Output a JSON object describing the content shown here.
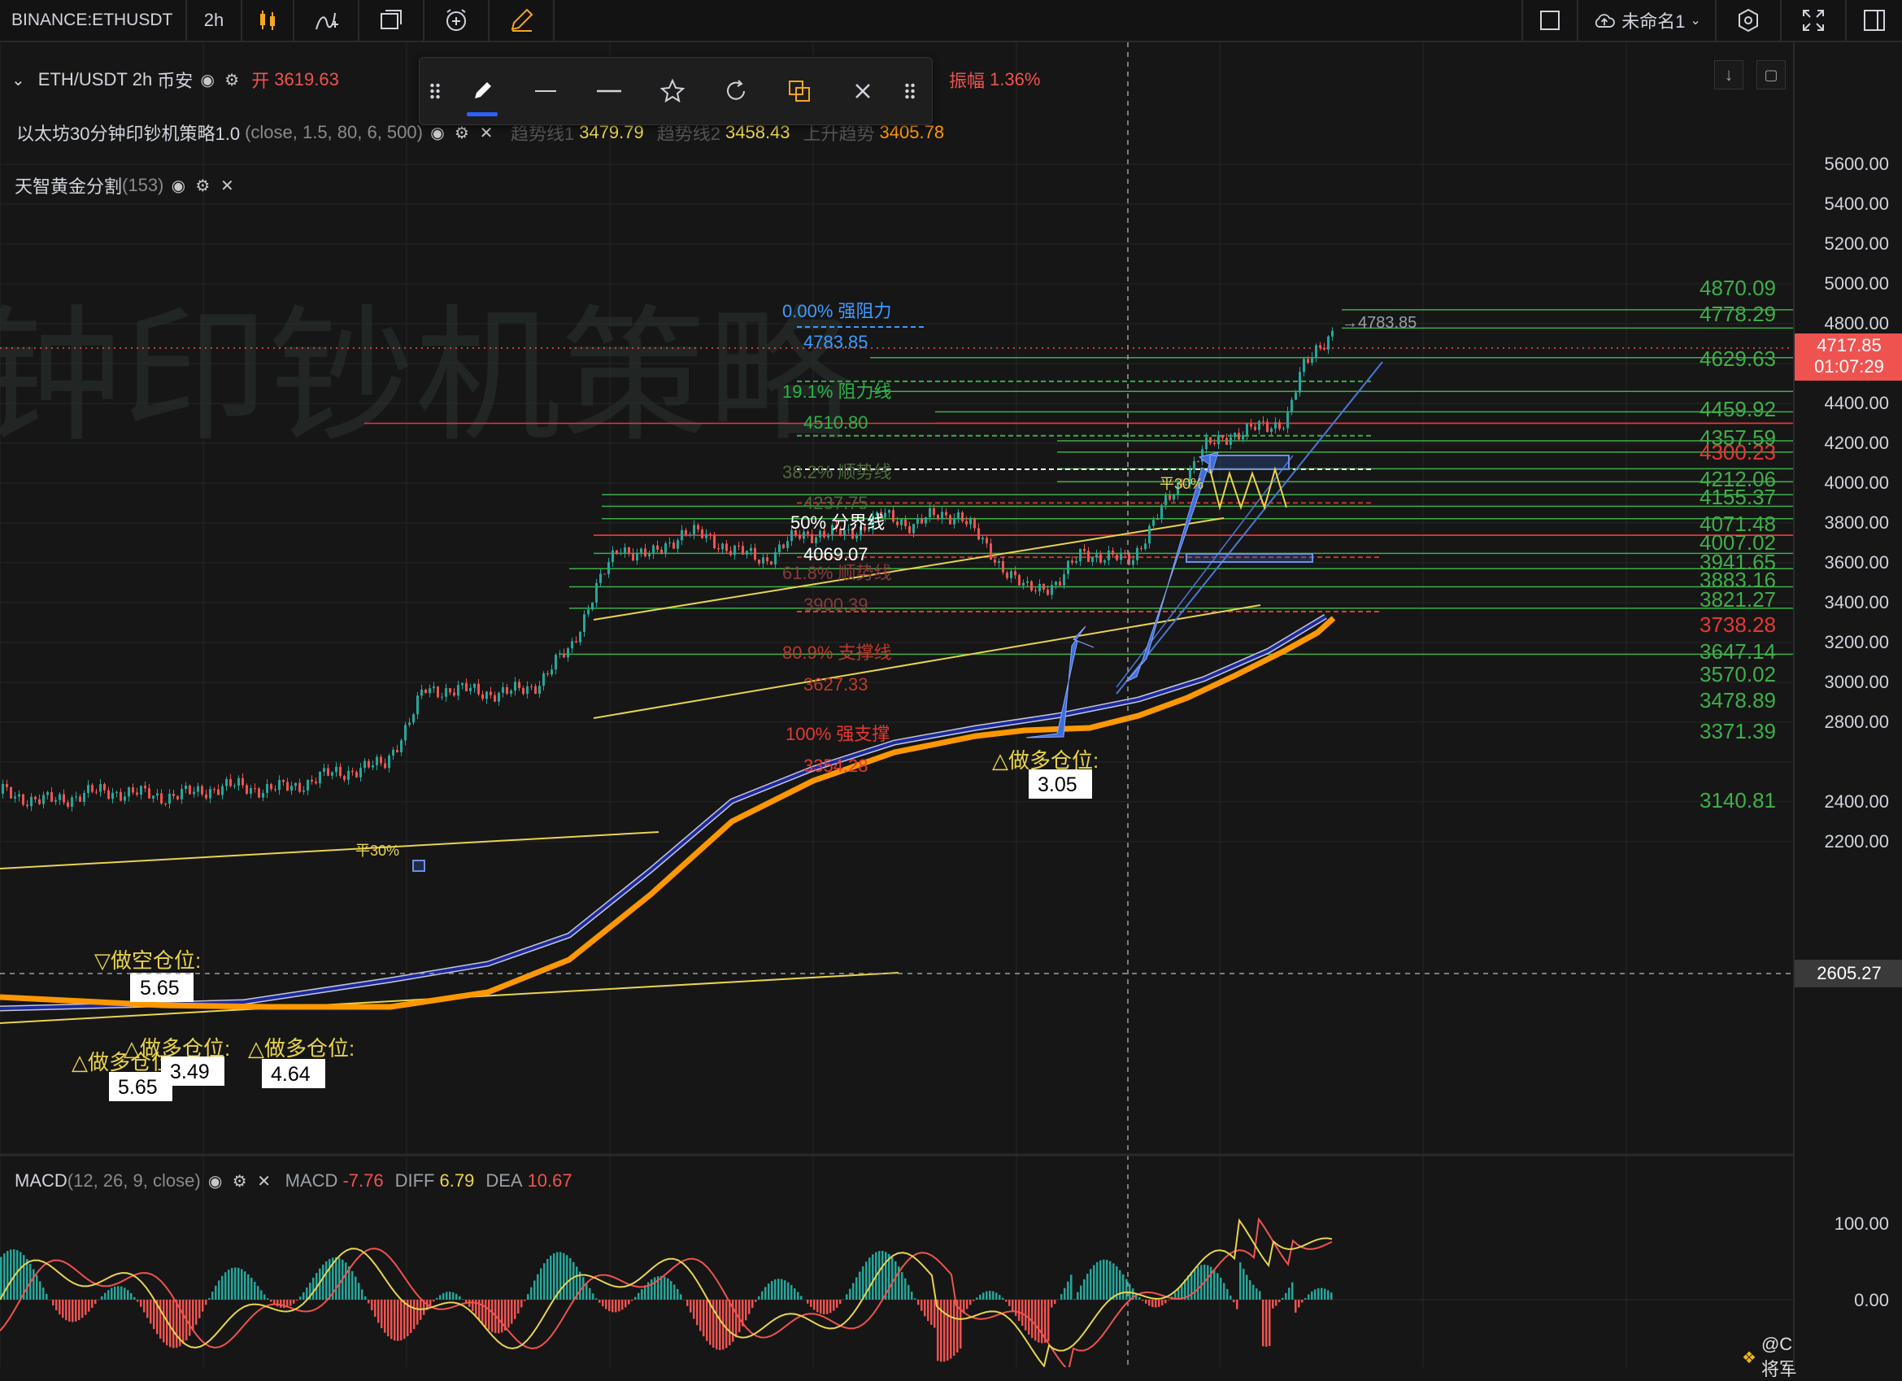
{
  "topbar": {
    "symbol": "BINANCE:ETHUSDT",
    "interval": "2h",
    "layout_name": "未命名1"
  },
  "legend": {
    "main": {
      "pair": "ETH/USDT",
      "interval": "2h",
      "exchange": "币安",
      "open_label": "开",
      "open_value": "3619.63",
      "range_label": "振幅",
      "range_value": "1.36%"
    },
    "strategy": {
      "name": "以太坊30分钟印钞机策略1.0",
      "params": "(close, 1.5, 80, 6, 500)",
      "trend1_label": "趋势线1",
      "trend1_value": "3479.79",
      "trend2_label": "趋势线2",
      "trend2_value": "3458.43",
      "up_label": "上升趋势",
      "up_value": "3405.78"
    },
    "golden": {
      "name": "天智黄金分割",
      "params": "(153)"
    },
    "macd": {
      "name": "MACD",
      "params": "(12, 26, 9, close)",
      "macd_label": "MACD",
      "macd_value": "-7.76",
      "diff_label": "DIFF",
      "diff_value": "6.79",
      "dea_label": "DEA",
      "dea_value": "10.67"
    }
  },
  "watermark": "钟印钞机策略",
  "fib": {
    "l0": {
      "pct": "0.00% 强阻力",
      "price": "4783.85"
    },
    "l19": {
      "pct": "19.1% 阻力线",
      "price": "4510.80"
    },
    "l38": {
      "pct": "38.2% 顺势线",
      "price": "4237.75"
    },
    "l50": {
      "pct": "50% 分界线",
      "price": "4069.07"
    },
    "l61": {
      "pct": "61.8% 顺势线",
      "price": "3900.39"
    },
    "l80": {
      "pct": "80.9% 支撑线",
      "price": "3627.33"
    },
    "l100": {
      "pct": "100% 强支撑",
      "price": "3354.28"
    }
  },
  "levels": [
    "4870.09",
    "4778.29",
    "4629.63",
    "4459.92",
    "4357.59",
    "4300.23",
    "4212.06",
    "4155.37",
    "4071.48",
    "4007.02",
    "3941.65",
    "3883.16",
    "3821.27",
    "3738.28",
    "3647.14",
    "3570.02",
    "3478.89",
    "3371.39",
    "3140.81"
  ],
  "annotations": {
    "short_pos": "▽做空仓位:",
    "short_val": "5.65",
    "long_pos": "△做多仓位:",
    "long_val1": "5.65",
    "long_val2": "3.49",
    "long_val3": "4.64",
    "long_val4": "3.05",
    "flat": "平30%",
    "high_marker": "4783.85"
  },
  "price_axis": {
    "labels": [
      "5600.00",
      "5400.00",
      "5200.00",
      "5000.00",
      "4800.00",
      "4600.00",
      "4400.00",
      "4200.00",
      "4000.00",
      "3800.00",
      "3600.00",
      "3400.00",
      "3200.00",
      "3000.00",
      "2800.00",
      "2400.00",
      "2200.00"
    ],
    "current_price": "4717.85",
    "countdown": "01:07:29",
    "crosshair_price": "2605.27",
    "macd_labels": [
      "100.00",
      "0.00"
    ]
  },
  "footer": {
    "credit": "@Crypto-将军"
  },
  "colors": {
    "up": "#26a69a",
    "down": "#ef5350",
    "fib_line": "#4caf50",
    "ma_orange": "#ff9800",
    "ma_blue": "#1a237e",
    "trend_yellow": "#e8d44d",
    "accent": "#2962ff"
  }
}
